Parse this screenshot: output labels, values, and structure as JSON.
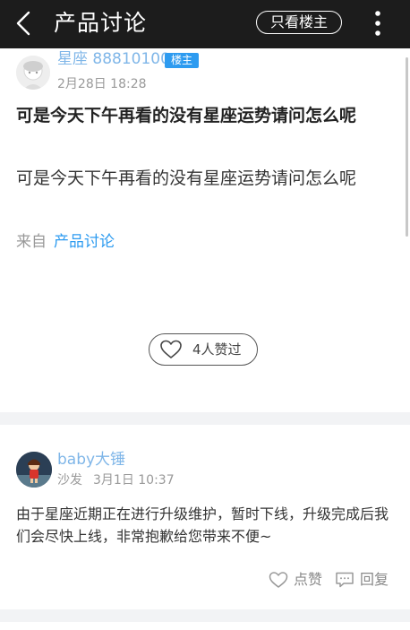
{
  "header": {
    "title": "产品讨论",
    "only_owner_label": "只看楼主"
  },
  "post": {
    "author": "星座 88810100",
    "owner_badge": "楼主",
    "time": "2月28日 18:28",
    "title": "可是今天下午再看的没有星座运势请问怎么呢",
    "body": "可是今天下午再看的没有星座运势请问怎么呢",
    "from_label": "来自",
    "from_link": "产品讨论",
    "like_count": "4人赞过"
  },
  "reply": {
    "author": "baby大锤",
    "floor": "沙发",
    "time": "3月1日 10:37",
    "body": "由于星座近期正在进行升级维护，暂时下线，升级完成后我们会尽快上线，非常抱歉给您带来不便~",
    "like_label": "点赞",
    "reply_label": "回复"
  },
  "colors": {
    "header_bg": "#1c1c1c",
    "accent": "#2d9bf0",
    "author_link": "#7fb6e8"
  }
}
